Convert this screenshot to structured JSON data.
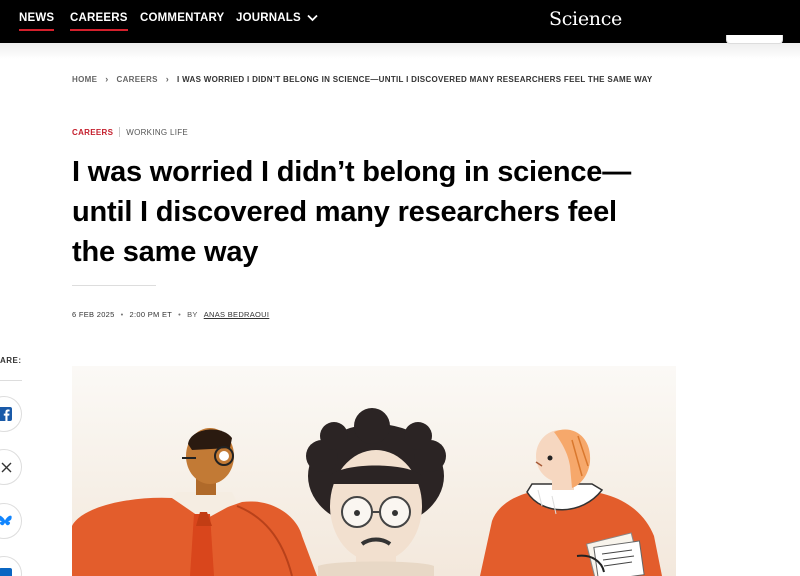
{
  "nav": {
    "items": [
      {
        "label": "NEWS",
        "active": true
      },
      {
        "label": "CAREERS",
        "active": true
      },
      {
        "label": "COMMENTARY"
      },
      {
        "label": "JOURNALS",
        "has_dropdown": true
      }
    ],
    "logo": "Science"
  },
  "breadcrumb": {
    "home": "HOME",
    "section": "CAREERS",
    "current": "I WAS WORRIED I DIDN’T BELONG IN SCIENCE—UNTIL I DISCOVERED MANY RESEARCHERS FEEL THE SAME WAY"
  },
  "category": {
    "primary": "CAREERS",
    "secondary": "WORKING LIFE"
  },
  "article": {
    "headline_lines": [
      "I was worried I didn’t belong in science—",
      "until I discovered many researchers feel",
      "the same way"
    ],
    "date": "6 FEB 2025",
    "time": "2:00 PM ET",
    "by": "BY",
    "author": "ANAS BEDRAOUI"
  },
  "share": {
    "label": "ARE:",
    "icons": [
      "facebook-icon",
      "x-icon",
      "bluesky-icon",
      "linkedin-icon"
    ]
  },
  "colors": {
    "accent_red": "#d4202c",
    "nav_bg": "#000000",
    "illustration_orange": "#e35d2c"
  }
}
